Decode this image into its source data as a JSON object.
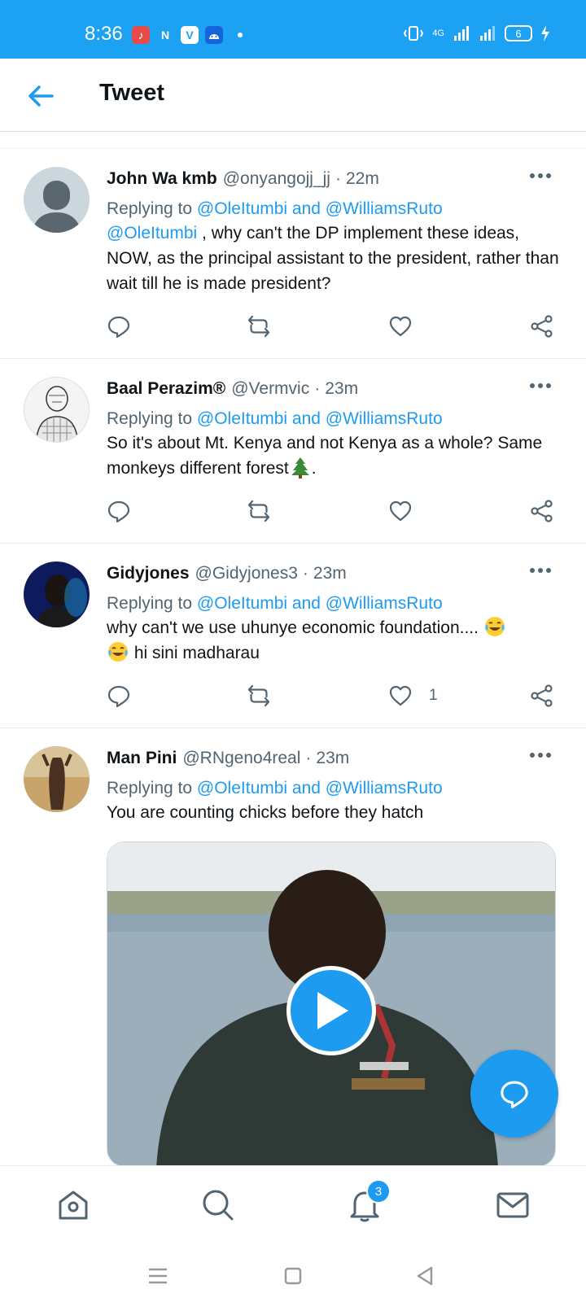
{
  "status_bar": {
    "time": "8:36",
    "battery": "6",
    "network": "4G",
    "accent": "#1da1f2"
  },
  "header": {
    "title": "Tweet"
  },
  "tweets": [
    {
      "name": "John Wa kmb",
      "handle": "@onyangojj_jj",
      "sep": "·",
      "time": "22m",
      "reply_prefix": "Replying to",
      "reply_to": "@OleItumbi and @WilliamsRuto",
      "mention": "@OleItumbi",
      "text": " , why can't the DP implement these ideas, NOW, as the principal assistant to the president, rather than wait till he is made president?",
      "avatar": "default-avatar-icon"
    },
    {
      "name": "Baal Perazim®",
      "handle": "@Vermvic",
      "sep": "·",
      "time": "23m",
      "reply_prefix": "Replying to",
      "reply_to": "@OleItumbi and @WilliamsRuto",
      "text": "So it's about Mt. Kenya and not Kenya as a whole? Same monkeys different forest",
      "text_end": ".",
      "emoji": "evergreen-tree-emoji"
    },
    {
      "name": "Gidyjones",
      "handle": "@Gidyjones3",
      "sep": "·",
      "time": "23m",
      "reply_prefix": "Replying to",
      "reply_to": "@OleItumbi and @WilliamsRuto",
      "text": "why can't we use uhunye economic foundation.... ",
      "text_end": " hi sini madharau",
      "emoji": "tears-of-joy-emoji",
      "like_count": "1"
    },
    {
      "name": "Man Pini",
      "handle": "@RNgeno4real",
      "sep": "·",
      "time": "23m",
      "reply_prefix": "Replying to",
      "reply_to": "@OleItumbi and @WilliamsRuto",
      "text": "You are counting chicks before they hatch",
      "media": "video-thumbnail"
    }
  ],
  "bottom_nav": {
    "notifications_badge": "3",
    "items": [
      "home-icon",
      "search-icon",
      "notifications-icon",
      "messages-icon"
    ]
  },
  "colors": {
    "link": "#1d9bf0",
    "secondary_text": "#536471"
  }
}
